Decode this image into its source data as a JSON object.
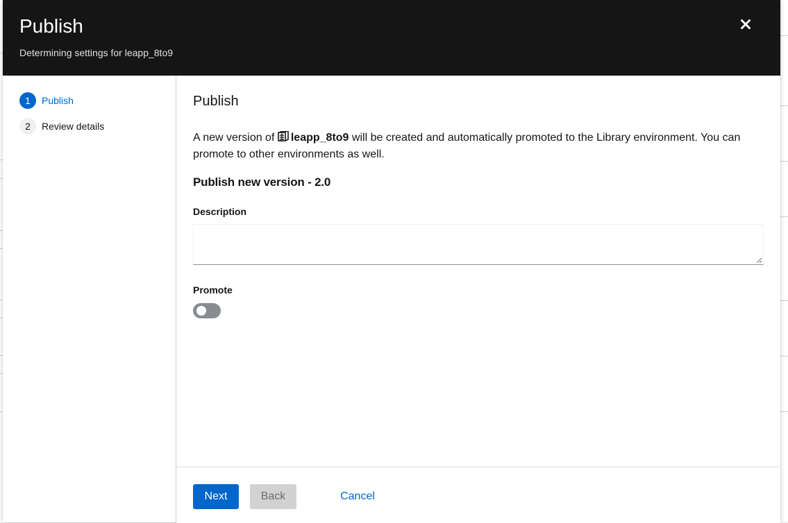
{
  "modal": {
    "title": "Publish",
    "subtitle": "Determining settings for leapp_8to9",
    "close_icon": "close-icon"
  },
  "wizard_nav": {
    "steps": [
      {
        "number": "1",
        "label": "Publish",
        "active": true
      },
      {
        "number": "2",
        "label": "Review details",
        "active": false
      }
    ]
  },
  "main": {
    "step_title": "Publish",
    "intro_prefix": "A new version of",
    "content_view_icon": "content-view-icon",
    "content_view_name": "leapp_8to9",
    "intro_suffix": "will be created and automatically promoted to the Library environment. You can promote to other environments as well.",
    "version_heading": "Publish new version - 2.0",
    "description_label": "Description",
    "description_value": "",
    "promote_label": "Promote",
    "promote_enabled": false
  },
  "footer": {
    "next_label": "Next",
    "back_label": "Back",
    "cancel_label": "Cancel"
  },
  "colors": {
    "header_bg": "#151515",
    "primary": "#0066cc",
    "disabled_bg": "#d2d2d2",
    "toggle_off": "#8a8d90"
  }
}
